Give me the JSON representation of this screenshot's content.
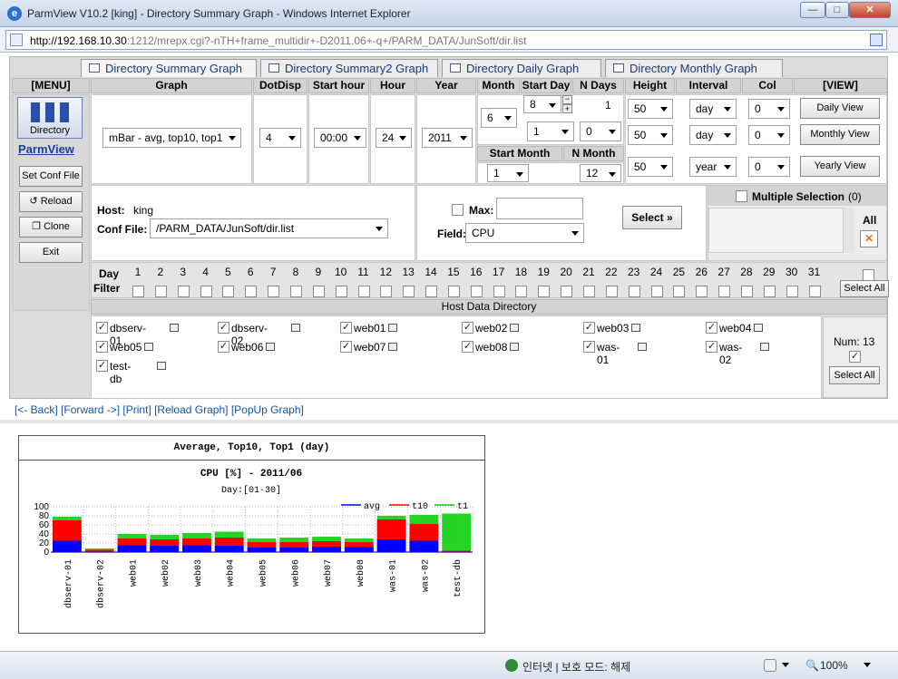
{
  "window": {
    "title": "ParmView V10.2 [king] - Directory Summary Graph - Windows Internet Explorer"
  },
  "address": {
    "host": "http://192.168.10.30",
    "path": ":1212/mrepx.cgi?-nTH+frame_multidir+-D2011.06+-q+/PARM_DATA/JunSoft/dir.list"
  },
  "tabs": [
    "Directory Summary Graph",
    "Directory Summary2 Graph",
    "Directory Daily Graph",
    "Directory Monthly Graph"
  ],
  "headers": {
    "menu": "[MENU]",
    "graph": "Graph",
    "dotdisp": "DotDisp",
    "start_hour": "Start hour",
    "hour": "Hour",
    "year": "Year",
    "month": "Month",
    "start_day": "Start Day",
    "n_days": "N Days",
    "height": "Height",
    "interval": "Interval",
    "col": "Col",
    "view": "[VIEW]",
    "start_month": "Start Month",
    "n_month": "N Month"
  },
  "menu": {
    "directory": "Directory",
    "brand": "ParmView",
    "set_conf": "Set Conf File",
    "reload": "Reload",
    "clone": "Clone",
    "exit": "Exit"
  },
  "controls": {
    "graph": "mBar - avg, top10, top1",
    "dotdisp": "4",
    "start_hour": "00:00",
    "hour": "24",
    "year": "2011",
    "month": "6",
    "start_day": "8",
    "n_days": "1",
    "start_day2": "1",
    "n_days2": "0",
    "start_month": "1",
    "n_month": "12",
    "rows": [
      {
        "height": "50",
        "interval": "day",
        "col": "0",
        "view": "Daily View"
      },
      {
        "height": "50",
        "interval": "day",
        "col": "0",
        "view": "Monthly View"
      },
      {
        "height": "50",
        "interval": "year",
        "col": "0",
        "view": "Yearly View"
      }
    ]
  },
  "hostinfo": {
    "host_label": "Host:",
    "host": "king",
    "conf_label": "Conf File:",
    "conf": "/PARM_DATA/JunSoft/dir.list",
    "max_label": "Max:",
    "field_label": "Field:",
    "field": "CPU",
    "select_btn": "Select",
    "multi_label": "Multiple Selection",
    "multi_count": "(0)",
    "all_label": "All"
  },
  "dayfilter": {
    "label1": "Day",
    "label2": "Filter",
    "days": [
      "1",
      "2",
      "3",
      "4",
      "5",
      "6",
      "7",
      "8",
      "9",
      "10",
      "11",
      "12",
      "13",
      "14",
      "15",
      "16",
      "17",
      "18",
      "19",
      "20",
      "21",
      "22",
      "23",
      "24",
      "25",
      "26",
      "27",
      "28",
      "29",
      "30",
      "31"
    ],
    "select_all": "Select All"
  },
  "hostdir": {
    "title": "Host Data Directory",
    "hosts": [
      "dbserv-01",
      "dbserv-02",
      "web01",
      "web02",
      "web03",
      "web04",
      "web05",
      "web06",
      "web07",
      "web08",
      "was-01",
      "was-02",
      "test-db"
    ],
    "num_label": "Num: 13",
    "select_all": "Select All"
  },
  "links": [
    "[<- Back]",
    "[Forward ->]",
    "[Print]",
    "[Reload Graph]",
    "[PopUp Graph]"
  ],
  "status": {
    "zone": "인터넷 | 보호 모드: 해제",
    "zoom": "100%"
  },
  "chart_data": {
    "type": "bar",
    "header": "Average, Top10, Top1 (day)",
    "title": "CPU [%] - 2011/06",
    "subtitle": "Day:[01-30]",
    "ylim": [
      0,
      100
    ],
    "yticks": [
      "100",
      "80",
      "60",
      "40",
      "20",
      "0"
    ],
    "categories": [
      "dbserv-01",
      "dbserv-02",
      "web01",
      "web02",
      "web03",
      "web04",
      "web05",
      "web06",
      "web07",
      "web08",
      "was-01",
      "was-02",
      "test-db"
    ],
    "series": [
      {
        "name": "avg",
        "color": "#0000ff",
        "values": [
          25,
          1,
          15,
          14,
          15,
          14,
          10,
          10,
          12,
          11,
          28,
          25,
          1
        ]
      },
      {
        "name": "t10",
        "color": "#ff0000",
        "values": [
          70,
          5,
          30,
          28,
          30,
          32,
          22,
          22,
          24,
          22,
          72,
          62,
          3
        ]
      },
      {
        "name": "t1",
        "color": "#00cc00",
        "values": [
          78,
          8,
          40,
          38,
          42,
          45,
          30,
          32,
          34,
          30,
          80,
          82,
          85
        ]
      }
    ]
  }
}
